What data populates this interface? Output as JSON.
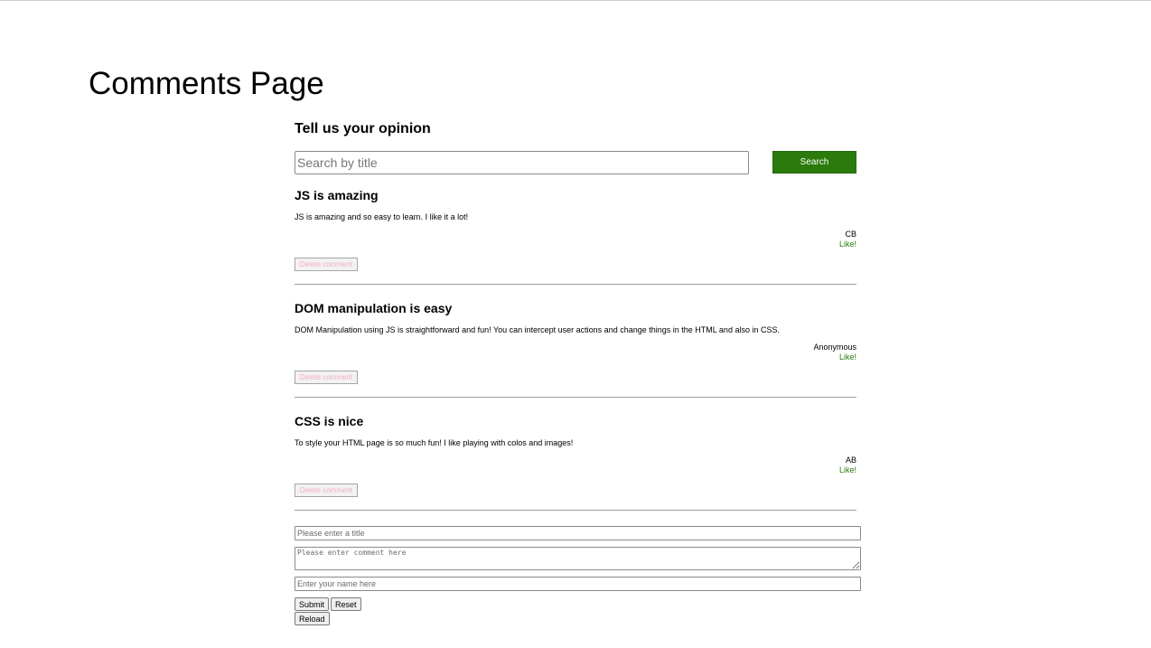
{
  "page": {
    "title": "Comments Page"
  },
  "main": {
    "subtitle": "Tell us your opinion",
    "search": {
      "placeholder": "Search by title",
      "button_label": "Search"
    }
  },
  "comments": [
    {
      "title": "JS is amazing",
      "body": "JS is amazing and so easy to learn. I like it a lot!",
      "author": "CB",
      "like_label": "Like!",
      "delete_label": "Delete comment"
    },
    {
      "title": "DOM manipulation is easy",
      "body": "DOM Manipulation using JS is straightforward and fun! You can intercept user actions and change things in the HTML and also in CSS.",
      "author": "Anonymous",
      "like_label": "Like!",
      "delete_label": "Delete comment"
    },
    {
      "title": "CSS is nice",
      "body": "To style your HTML page is so much fun! I like playing with colos and images!",
      "author": "AB",
      "like_label": "Like!",
      "delete_label": "Delete comment"
    }
  ],
  "form": {
    "title_placeholder": "Please enter a title",
    "comment_placeholder": "Please enter comment here",
    "name_placeholder": "Enter your name here",
    "submit_label": "Submit",
    "reset_label": "Reset",
    "reload_label": "Reload"
  },
  "colors": {
    "accent": "#2b7a0b",
    "delete_text": "#f1b0c0",
    "divider": "#9c9c9c"
  }
}
